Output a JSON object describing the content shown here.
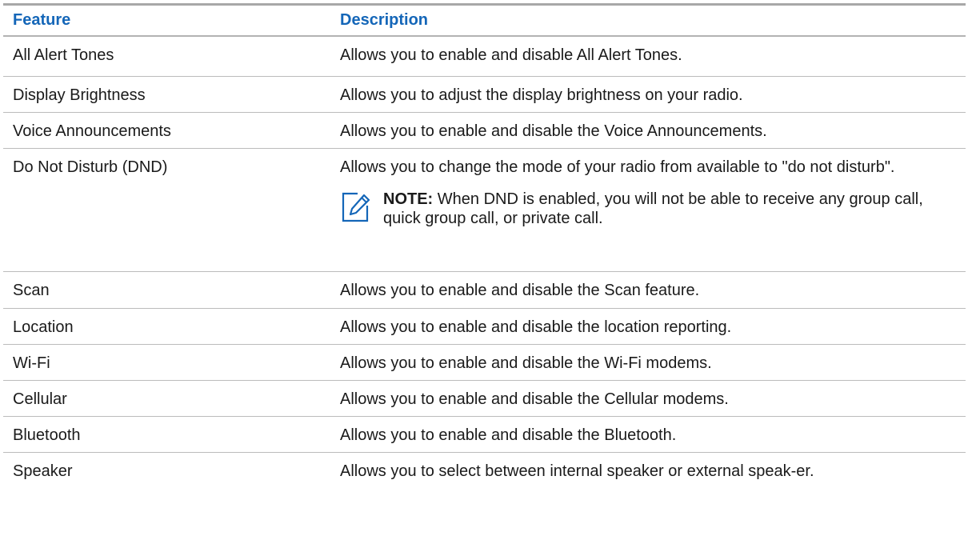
{
  "table": {
    "headers": {
      "feature": "Feature",
      "description": "Description"
    },
    "rows": [
      {
        "feature": "All Alert Tones",
        "description": "Allows you to enable and disable All Alert Tones."
      },
      {
        "feature": "Display Brightness",
        "description": "Allows you to adjust the display brightness on your radio."
      },
      {
        "feature": "Voice Announcements",
        "description": "Allows you to enable and disable the Voice Announcements."
      },
      {
        "feature": "Do Not Disturb (DND)",
        "description": "Allows you to change the mode of your radio from available to \"do not disturb\"."
      },
      {
        "feature": "Scan",
        "description": "Allows you to enable and disable the Scan feature."
      },
      {
        "feature": "Location",
        "description": "Allows you to enable and disable the location reporting."
      },
      {
        "feature": "Wi-Fi",
        "description": "Allows you to enable and disable the Wi-Fi modems."
      },
      {
        "feature": "Cellular",
        "description": "Allows you to enable and disable the Cellular modems."
      },
      {
        "feature": "Bluetooth",
        "description": "Allows you to enable and disable the Bluetooth."
      },
      {
        "feature": "Speaker",
        "description": "Allows you to select between internal speaker or external speak-er."
      }
    ],
    "note": {
      "label": "NOTE:",
      "text": " When DND is enabled, you will not be able to receive any group call, quick group call, or private call.",
      "icon": "note-pencil-icon"
    }
  },
  "colors": {
    "header_text": "#1466b8",
    "note_icon": "#1466b8",
    "rule": "#bcbcbc"
  }
}
